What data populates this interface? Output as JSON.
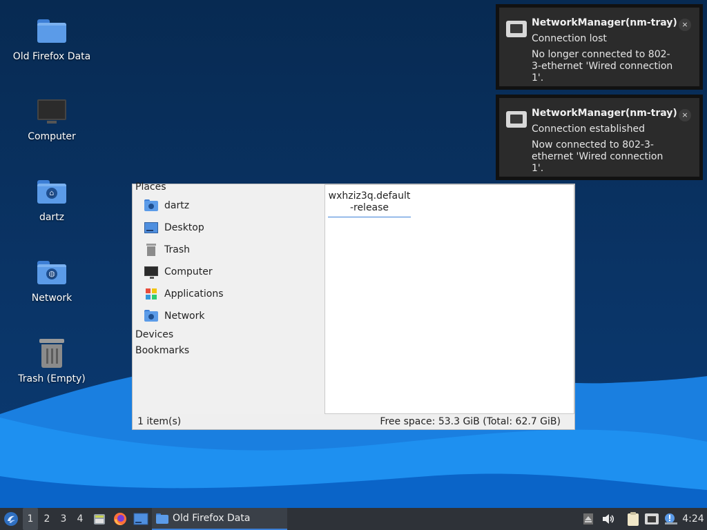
{
  "desktop": {
    "icons": [
      {
        "label": "Old Firefox Data",
        "icon": "folder-icon"
      },
      {
        "label": "Computer",
        "icon": "computer-icon"
      },
      {
        "label": "dartz",
        "icon": "home-folder-icon"
      },
      {
        "label": "Network",
        "icon": "network-folder-icon"
      },
      {
        "label": "Trash (Empty)",
        "icon": "trash-icon"
      }
    ]
  },
  "file_manager": {
    "sidebar": {
      "places_heading": "Places",
      "places": [
        {
          "label": "dartz",
          "icon": "home-folder-icon"
        },
        {
          "label": "Desktop",
          "icon": "desktop-icon"
        },
        {
          "label": "Trash",
          "icon": "trash-icon"
        },
        {
          "label": "Computer",
          "icon": "computer-icon"
        },
        {
          "label": "Applications",
          "icon": "applications-icon"
        },
        {
          "label": "Network",
          "icon": "network-folder-icon"
        }
      ],
      "devices_heading": "Devices",
      "bookmarks_heading": "Bookmarks"
    },
    "content": {
      "items": [
        {
          "name": "wxhziz3q.default-release",
          "name_line1": "wxhziz3q.default",
          "name_line2": "-release"
        }
      ]
    },
    "status": {
      "item_count": "1 item(s)",
      "free_space": "Free space: 53.3 GiB (Total: 62.7 GiB)"
    }
  },
  "notifications": [
    {
      "app": "NetworkManager(nm-tray)",
      "summary": "Connection lost",
      "body": "No longer connected to 802-3-ethernet 'Wired connection 1'.",
      "close": "×"
    },
    {
      "app": "NetworkManager(nm-tray)",
      "summary": "Connection established",
      "body": "Now connected to 802-3-ethernet 'Wired connection 1'.",
      "close": "×"
    }
  ],
  "taskbar": {
    "workspaces": [
      "1",
      "2",
      "3",
      "4"
    ],
    "active_workspace": "1",
    "launchers": [
      "file-manager-icon",
      "firefox-icon",
      "show-desktop-icon"
    ],
    "task": {
      "label": "Old Firefox Data",
      "icon": "folder-icon"
    },
    "tray": [
      "eject-icon",
      "volume-icon",
      "clipboard-icon",
      "network-wired-icon",
      "update-notifier-icon"
    ],
    "clock": "4:24"
  },
  "colors": {
    "desktop_bg": "#072a52",
    "wave_light": "#1e90f0",
    "wave_dark": "#0a64c8",
    "accent": "#3b7fd6",
    "taskbar_bg": "#2e3238",
    "notification_bg": "#2b2b2b"
  }
}
